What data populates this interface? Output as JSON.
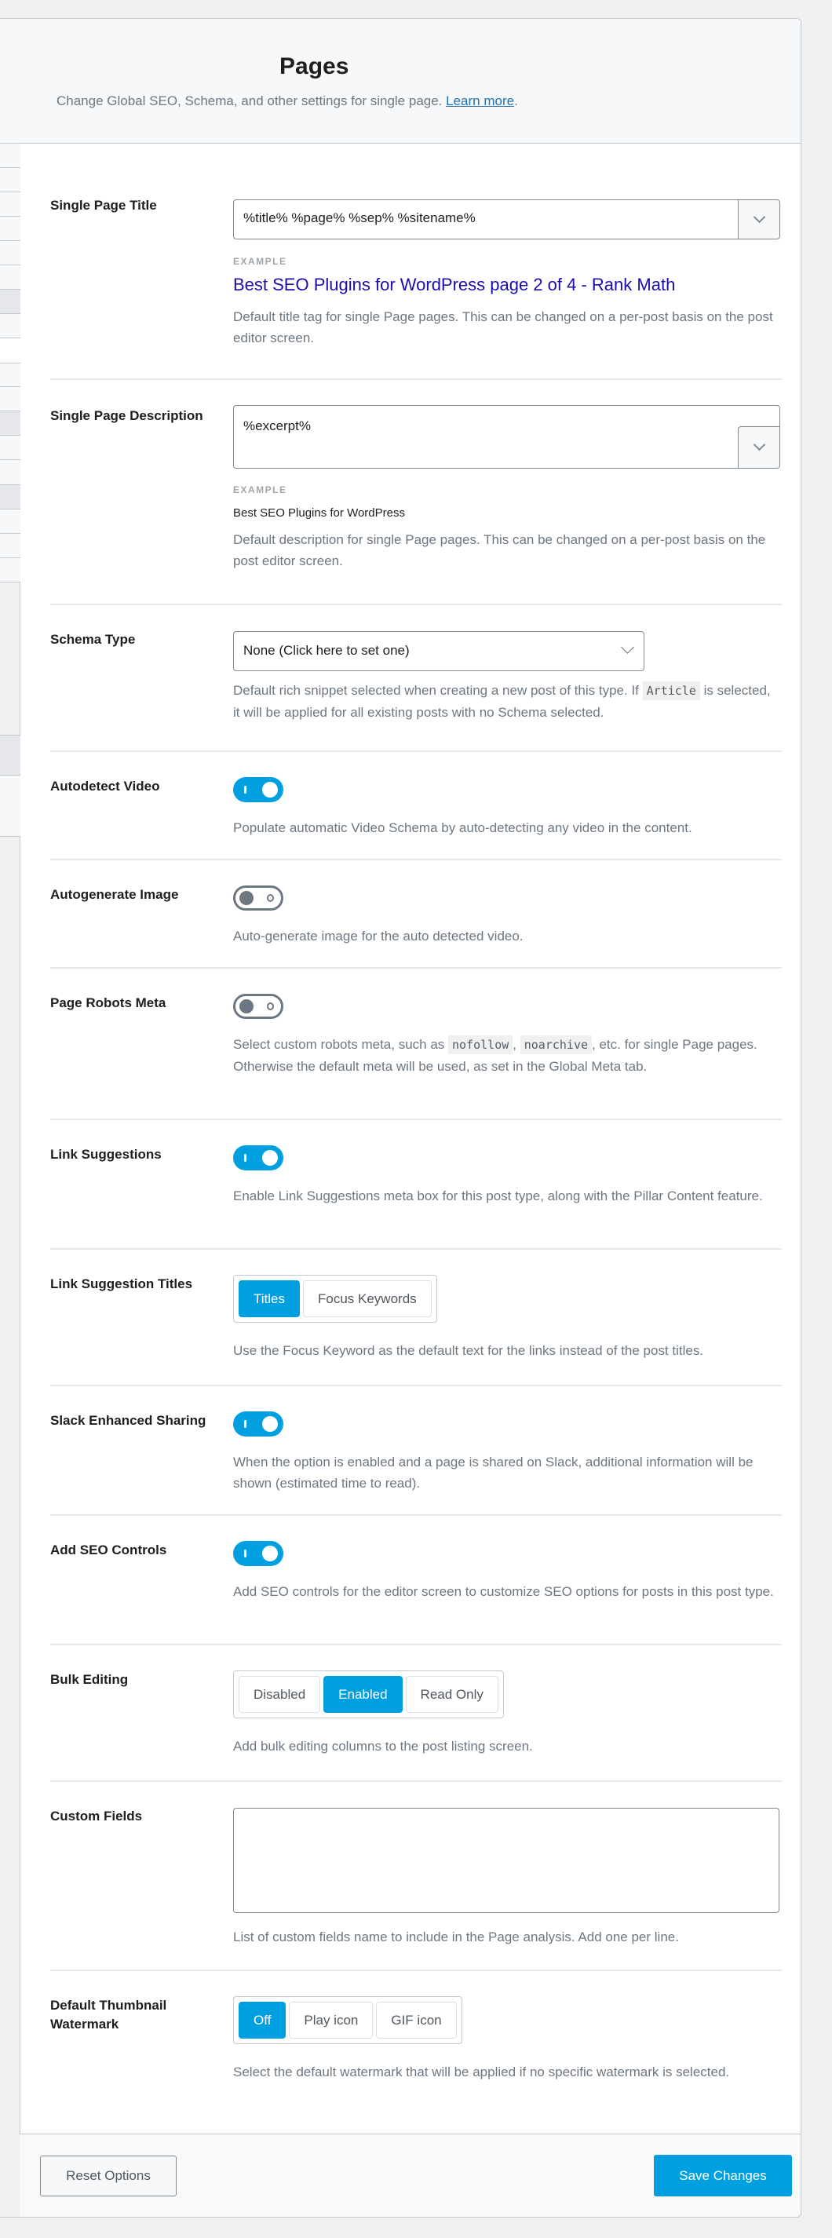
{
  "header": {
    "title": "Pages",
    "description": "Change Global SEO, Schema, and other settings for single page.",
    "learn_more": "Learn more",
    "period": "."
  },
  "colors": {
    "accent": "#00a0e0",
    "link": "#2271b1",
    "example_title": "#1a0dab",
    "help_text": "#6c7781"
  },
  "settings": {
    "single_page_title": {
      "label": "Single Page Title",
      "value": "%title% %page% %sep% %sitename%",
      "example_label": "EXAMPLE",
      "example": "Best SEO Plugins for WordPress page 2 of 4 - Rank Math",
      "help": "Default title tag for single Page pages. This can be changed on a per-post basis on the post editor screen."
    },
    "single_page_description": {
      "label": "Single Page Description",
      "value": "%excerpt%",
      "example_label": "EXAMPLE",
      "example": "Best SEO Plugins for WordPress",
      "help": "Default description for single Page pages. This can be changed on a per-post basis on the post editor screen."
    },
    "schema_type": {
      "label": "Schema Type",
      "value": "None (Click here to set one)",
      "help_before": "Default rich snippet selected when creating a new post of this type. If",
      "help_code": "Article",
      "help_after": "is selected, it will be applied for all existing posts with no Schema selected."
    },
    "autodetect_video": {
      "label": "Autodetect Video",
      "enabled": true,
      "help": "Populate automatic Video Schema by auto-detecting any video in the content."
    },
    "autogenerate_image": {
      "label": "Autogenerate Image",
      "enabled": false,
      "help": "Auto-generate image for the auto detected video."
    },
    "page_robots_meta": {
      "label": "Page Robots Meta",
      "enabled": false,
      "help_before": "Select custom robots meta, such as",
      "help_code1": "nofollow",
      "help_sep": ",",
      "help_code2": "noarchive",
      "help_after": ", etc. for single Page pages. Otherwise the default meta will be used, as set in the Global Meta tab."
    },
    "link_suggestions": {
      "label": "Link Suggestions",
      "enabled": true,
      "help": "Enable Link Suggestions meta box for this post type, along with the Pillar Content feature."
    },
    "link_suggestion_titles": {
      "label": "Link Suggestion Titles",
      "options": [
        "Titles",
        "Focus Keywords"
      ],
      "selected": "Titles",
      "help": "Use the Focus Keyword as the default text for the links instead of the post titles."
    },
    "slack_enhanced_sharing": {
      "label": "Slack Enhanced Sharing",
      "enabled": true,
      "help": "When the option is enabled and a page is shared on Slack, additional information will be shown (estimated time to read)."
    },
    "add_seo_controls": {
      "label": "Add SEO Controls",
      "enabled": true,
      "help": "Add SEO controls for the editor screen to customize SEO options for posts in this post type."
    },
    "bulk_editing": {
      "label": "Bulk Editing",
      "options": [
        "Disabled",
        "Enabled",
        "Read Only"
      ],
      "selected": "Enabled",
      "help": "Add bulk editing columns to the post listing screen."
    },
    "custom_fields": {
      "label": "Custom Fields",
      "value": "",
      "help": "List of custom fields name to include in the Page analysis. Add one per line."
    },
    "default_thumbnail_watermark": {
      "label": "Default Thumbnail Watermark",
      "options": [
        "Off",
        "Play icon",
        "GIF icon"
      ],
      "selected": "Off",
      "help": "Select the default watermark that will be applied if no specific watermark is selected."
    }
  },
  "footer": {
    "reset_label": "Reset Options",
    "save_label": "Save Changes"
  }
}
